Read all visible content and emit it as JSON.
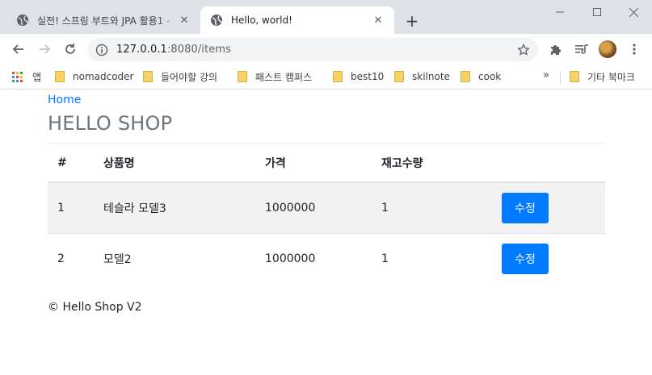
{
  "browser": {
    "tabs": [
      {
        "title": "실전! 스프링 부트와 JPA 활용1 - ",
        "active": false
      },
      {
        "title": "Hello, world!",
        "active": true
      }
    ],
    "new_tab_label": "+",
    "url": {
      "host": "127.0.0.1",
      "rest": ":8080/items"
    },
    "bookmarks": [
      {
        "label": "앱",
        "kind": "apps"
      },
      {
        "label": "nomadcoder",
        "kind": "folder"
      },
      {
        "label": "들어야할 강의",
        "kind": "folder"
      },
      {
        "label": "패스트 캠퍼스",
        "kind": "folder"
      },
      {
        "label": "best10",
        "kind": "folder"
      },
      {
        "label": "skilnote",
        "kind": "folder"
      },
      {
        "label": "cook",
        "kind": "folder"
      },
      {
        "label": "기타 북마크",
        "kind": "folder"
      }
    ],
    "overflow_label": "»",
    "icons": {
      "back": "arrow-left-icon",
      "forward": "arrow-right-icon",
      "reload": "reload-icon",
      "site_info": "info-icon",
      "bookmark": "star-icon",
      "extensions": "puzzle-icon",
      "reading_list": "reading-list-icon"
    }
  },
  "page": {
    "home_link": "Home",
    "brand": "HELLO SHOP",
    "table": {
      "headers": [
        "#",
        "상품명",
        "가격",
        "재고수량",
        ""
      ],
      "rows": [
        {
          "id": "1",
          "name": "테슬라 모델3",
          "price": "1000000",
          "stock": "1",
          "action": "수정"
        },
        {
          "id": "2",
          "name": "모델2",
          "price": "1000000",
          "stock": "1",
          "action": "수정"
        }
      ]
    },
    "footer": "© Hello Shop V2"
  },
  "colors": {
    "link": "#007bff",
    "button": "#007bff",
    "brand": "#6c757d",
    "stripe": "#f2f2f2",
    "tabstrip": "#dee1e6"
  }
}
